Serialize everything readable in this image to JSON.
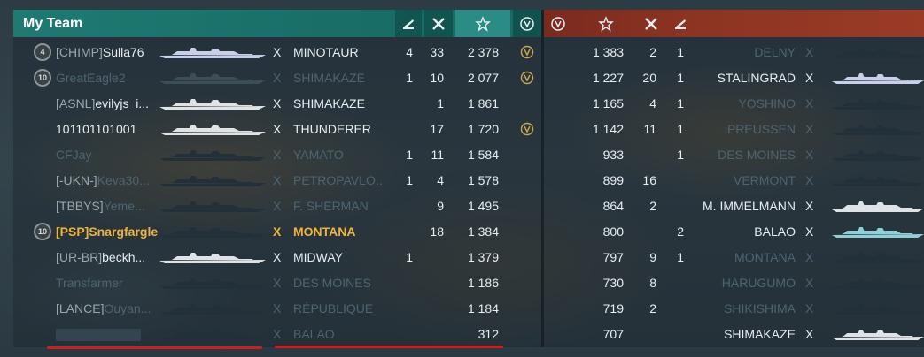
{
  "left": {
    "title": "My Team",
    "columns": [
      "destroyed-planes-icon",
      "kills-icon",
      "base-xp-star-icon",
      "achievement-icon"
    ],
    "rows": [
      {
        "rank": "4",
        "clan": "[CHIMP]",
        "name": "Sulla76",
        "x": "X",
        "ship": "MINOTAUR",
        "planes": "4",
        "kills": "33",
        "xp": "2 378",
        "medal": true,
        "state": "normal",
        "shipcolor": "#c9cfe8"
      },
      {
        "rank": "10",
        "clan": "",
        "name": "GreatEagle2",
        "x": "X",
        "ship": "SHIMAKAZE",
        "planes": "1",
        "kills": "10",
        "xp": "2 077",
        "medal": true,
        "state": "dim",
        "shipcolor": "#3d4e57"
      },
      {
        "rank": "",
        "clan": "[ASNL]",
        "name": "evilyjs_i...",
        "x": "X",
        "ship": "SHIMAKAZE",
        "planes": "",
        "kills": "1",
        "xp": "1 861",
        "medal": false,
        "state": "normal",
        "shipcolor": "#dfe3e6"
      },
      {
        "rank": "",
        "clan": "",
        "name": "101101101001",
        "x": "X",
        "ship": "THUNDERER",
        "planes": "",
        "kills": "17",
        "xp": "1 720",
        "medal": true,
        "state": "normal",
        "shipcolor": "#dfe3e6"
      },
      {
        "rank": "",
        "clan": "",
        "name": "CFJay",
        "x": "X",
        "ship": "YAMATO",
        "planes": "1",
        "kills": "11",
        "xp": "1 584",
        "medal": false,
        "state": "dim",
        "shipcolor": "#22303a"
      },
      {
        "rank": "",
        "clan": "[-UKN-]",
        "name": "Keva30...",
        "x": "X",
        "ship": "PETROPAVLO...",
        "planes": "1",
        "kills": "4",
        "xp": "1 578",
        "medal": false,
        "state": "dim-name",
        "shipcolor": "#22303a"
      },
      {
        "rank": "",
        "clan": "[TBBYS]",
        "name": "Yeme...",
        "x": "X",
        "ship": "F. SHERMAN",
        "planes": "",
        "kills": "9",
        "xp": "1 495",
        "medal": false,
        "state": "dim-name",
        "shipcolor": "#22303a"
      },
      {
        "rank": "10",
        "clan": "[PSP]",
        "name": "Snargfargle",
        "x": "X",
        "ship": "MONTANA",
        "planes": "",
        "kills": "18",
        "xp": "1 384",
        "medal": false,
        "state": "self",
        "shipcolor": "#22303a"
      },
      {
        "rank": "",
        "clan": "[UR-BR]",
        "name": "beckh...",
        "x": "X",
        "ship": "MIDWAY",
        "planes": "1",
        "kills": "",
        "xp": "1 379",
        "medal": false,
        "state": "normal",
        "shipcolor": "#dfe3e6"
      },
      {
        "rank": "",
        "clan": "",
        "name": "Transfarmer",
        "x": "X",
        "ship": "DES MOINES",
        "planes": "",
        "kills": "",
        "xp": "1 186",
        "medal": false,
        "state": "dim",
        "shipcolor": "#22303a"
      },
      {
        "rank": "",
        "clan": "[LANCE]",
        "name": "Ouyan...",
        "x": "X",
        "ship": "RÉPUBLIQUE",
        "planes": "",
        "kills": "",
        "xp": "1 184",
        "medal": false,
        "state": "dim-name",
        "shipcolor": "#22303a"
      },
      {
        "rank": "",
        "clan": "",
        "name": "",
        "x": "X",
        "ship": "BALAO",
        "planes": "",
        "kills": "",
        "xp": "312",
        "medal": false,
        "state": "dim",
        "shipcolor": "#22303a"
      }
    ]
  },
  "right": {
    "columns": [
      "achievement-icon",
      "base-xp-star-icon",
      "kills-icon",
      "destroyed-planes-icon"
    ],
    "rows": [
      {
        "xp": "1 383",
        "kills": "2",
        "planes": "1",
        "ship": "DELNY",
        "x": "X",
        "state": "dim",
        "shipcolor": "#22303a"
      },
      {
        "xp": "1 227",
        "kills": "20",
        "planes": "1",
        "ship": "STALINGRAD",
        "x": "X",
        "state": "normal",
        "shipcolor": "#c9cfe8"
      },
      {
        "xp": "1 165",
        "kills": "4",
        "planes": "1",
        "ship": "YOSHINO",
        "x": "X",
        "state": "dim",
        "shipcolor": "#22303a"
      },
      {
        "xp": "1 142",
        "kills": "11",
        "planes": "1",
        "ship": "PREUSSEN",
        "x": "X",
        "state": "dim",
        "shipcolor": "#22303a"
      },
      {
        "xp": "933",
        "kills": "",
        "planes": "1",
        "ship": "DES MOINES",
        "x": "X",
        "state": "dim",
        "shipcolor": "#22303a"
      },
      {
        "xp": "899",
        "kills": "16",
        "planes": "",
        "ship": "VERMONT",
        "x": "X",
        "state": "dim",
        "shipcolor": "#22303a"
      },
      {
        "xp": "864",
        "kills": "2",
        "planes": "",
        "ship": "M. IMMELMANN",
        "x": "X",
        "state": "normal",
        "shipcolor": "#dfe3e6"
      },
      {
        "xp": "800",
        "kills": "",
        "planes": "2",
        "ship": "BALAO",
        "x": "X",
        "state": "normal",
        "shipcolor": "#8fd0d6"
      },
      {
        "xp": "797",
        "kills": "9",
        "planes": "1",
        "ship": "MONTANA",
        "x": "X",
        "state": "dim",
        "shipcolor": "#22303a"
      },
      {
        "xp": "730",
        "kills": "8",
        "planes": "",
        "ship": "HARUGUMO",
        "x": "X",
        "state": "dim",
        "shipcolor": "#22303a"
      },
      {
        "xp": "719",
        "kills": "2",
        "planes": "",
        "ship": "SHIKISHIMA",
        "x": "X",
        "state": "dim",
        "shipcolor": "#22303a"
      },
      {
        "xp": "707",
        "kills": "",
        "planes": "",
        "ship": "SHIMAKAZE",
        "x": "X",
        "state": "normal",
        "shipcolor": "#dfe3e6"
      }
    ]
  },
  "colors": {
    "allies": "#1f7a72",
    "enemies": "#8d3422",
    "self": "#f0b33a",
    "underline": "#d21c1c"
  }
}
